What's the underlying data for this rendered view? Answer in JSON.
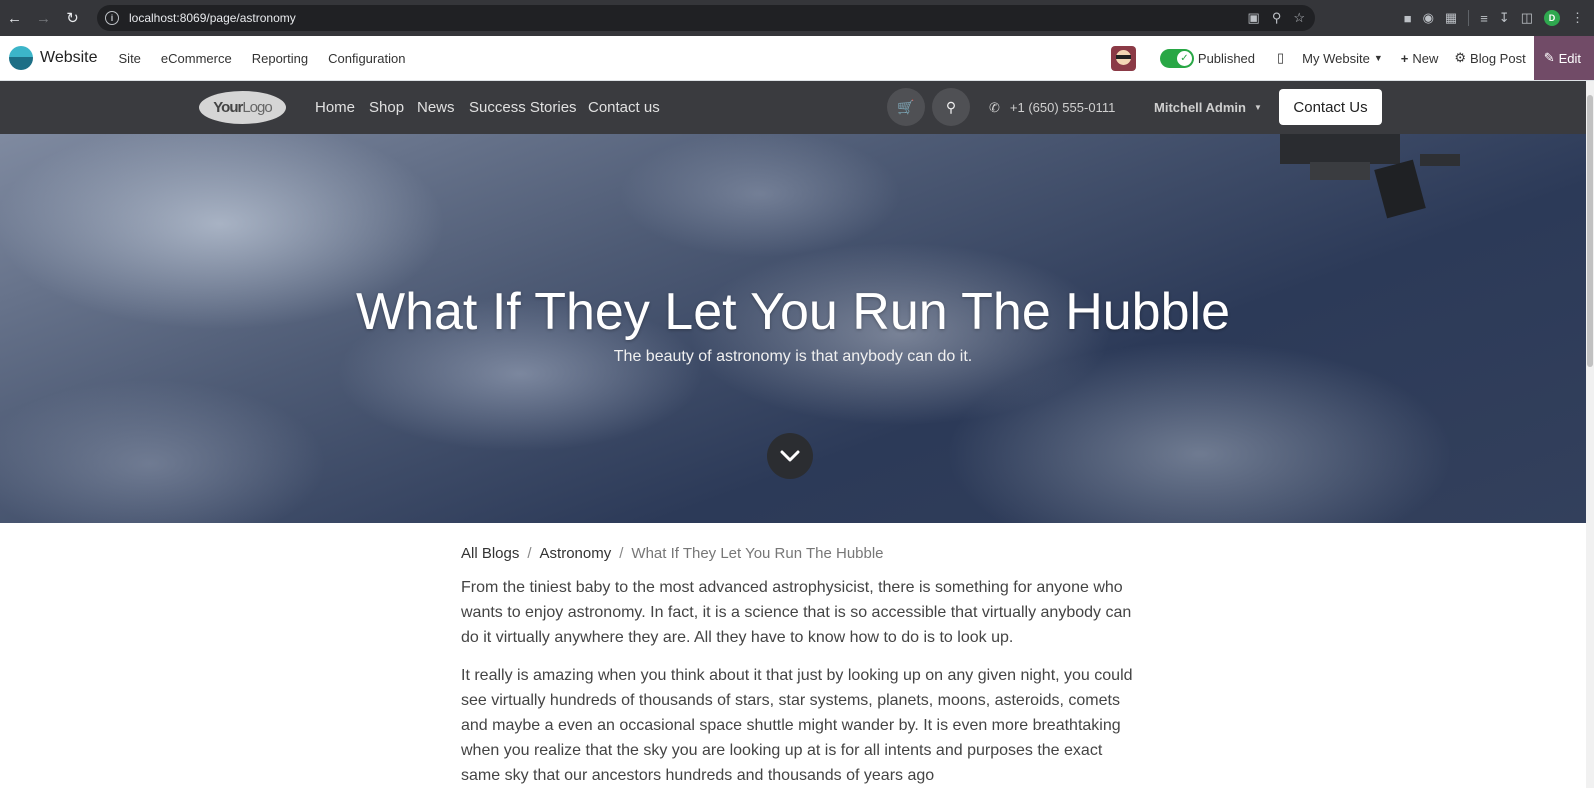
{
  "browser": {
    "url": "localhost:8069/page/astronomy",
    "profile_initial": "D"
  },
  "odoo_bar": {
    "app_name": "Website",
    "menus": [
      "Site",
      "eCommerce",
      "Reporting",
      "Configuration"
    ],
    "published_label": "Published",
    "website_label": "My Website",
    "new_label": "New",
    "blog_post_label": "Blog Post",
    "edit_label": "Edit"
  },
  "site_nav": {
    "logo_text_a": "Your",
    "logo_text_b": "Logo",
    "links": [
      "Home",
      "Shop",
      "News",
      "Success Stories",
      "Contact us"
    ],
    "phone": "+1 (650) 555-0111",
    "user": "Mitchell Admin",
    "contact_button": "Contact Us"
  },
  "hero": {
    "title": "What If They Let You Run The Hubble",
    "subtitle": "The beauty of astronomy is that anybody can do it."
  },
  "breadcrumb": {
    "items": [
      "All Blogs",
      "Astronomy"
    ],
    "current": "What If They Let You Run The Hubble"
  },
  "article": {
    "paragraphs": [
      "From the tiniest baby to the most advanced astrophysicist, there is something for anyone who wants to enjoy astronomy. In fact, it is a science that is so accessible that virtually anybody can do it virtually anywhere they are. All they have to know how to do is to look up.",
      "It really is amazing when you think about it that just by looking up on any given night, you could see virtually hundreds of thousands of stars, star systems, planets, moons, asteroids, comets and maybe a even an occasional space shuttle might wander by. It is even more breathtaking when you realize that the sky you are looking up at is for all intents and purposes the exact same sky that our ancestors hundreds and thousands of years ago"
    ]
  },
  "colors": {
    "edit_accent": "#714b67",
    "published_toggle": "#28a745",
    "site_nav_bg": "#3a3b3f"
  }
}
